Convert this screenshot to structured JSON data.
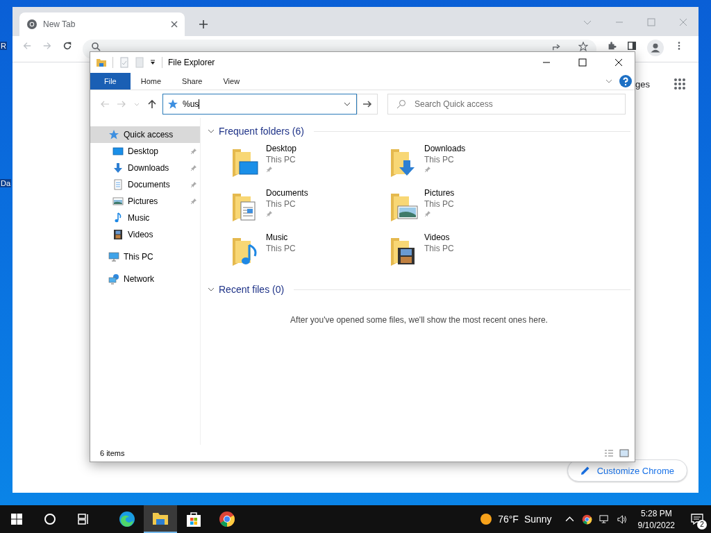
{
  "desktop": {
    "icon_labels": [
      "R",
      "Da"
    ]
  },
  "chrome": {
    "tab": {
      "title": "New Tab"
    },
    "partial_link": "ges",
    "customize_button": "Customize Chrome"
  },
  "explorer": {
    "title": "File Explorer",
    "ribbon_tabs": [
      {
        "label": "File",
        "selected": true
      },
      {
        "label": "Home",
        "selected": false
      },
      {
        "label": "Share",
        "selected": false
      },
      {
        "label": "View",
        "selected": false
      }
    ],
    "address": {
      "value": "%us"
    },
    "search": {
      "placeholder": "Search Quick access"
    },
    "nav": [
      {
        "label": "Quick access",
        "kind": "quick",
        "selected": true,
        "children": [
          {
            "label": "Desktop",
            "kind": "desktop",
            "pinned": true
          },
          {
            "label": "Downloads",
            "kind": "downloads",
            "pinned": true
          },
          {
            "label": "Documents",
            "kind": "documents",
            "pinned": true
          },
          {
            "label": "Pictures",
            "kind": "pictures",
            "pinned": true
          },
          {
            "label": "Music",
            "kind": "music",
            "pinned": false
          },
          {
            "label": "Videos",
            "kind": "videos",
            "pinned": false
          }
        ]
      },
      {
        "label": "This PC",
        "kind": "pc",
        "selected": false
      },
      {
        "label": "Network",
        "kind": "network",
        "selected": false
      }
    ],
    "frequent": {
      "title": "Frequent folders (6)",
      "expanded": true,
      "folders": [
        {
          "name": "Desktop",
          "location": "This PC",
          "pinned": true,
          "kind": "desktop"
        },
        {
          "name": "Downloads",
          "location": "This PC",
          "pinned": true,
          "kind": "downloads"
        },
        {
          "name": "Documents",
          "location": "This PC",
          "pinned": true,
          "kind": "documents"
        },
        {
          "name": "Pictures",
          "location": "This PC",
          "pinned": true,
          "kind": "pictures"
        },
        {
          "name": "Music",
          "location": "This PC",
          "pinned": false,
          "kind": "music"
        },
        {
          "name": "Videos",
          "location": "This PC",
          "pinned": false,
          "kind": "videos"
        }
      ]
    },
    "recent": {
      "title": "Recent files (0)",
      "expanded": true,
      "message": "After you've opened some files, we'll show the most recent ones here."
    },
    "status": "6 items"
  },
  "taskbar": {
    "apps": [
      {
        "kind": "edge",
        "selected": false
      },
      {
        "kind": "explorer",
        "selected": true
      },
      {
        "kind": "store",
        "selected": false
      },
      {
        "kind": "chrome",
        "selected": false
      }
    ],
    "weather": {
      "temperature": "76°F",
      "condition": "Sunny"
    },
    "time": "5:28 PM",
    "date": "9/10/2022",
    "notifications": "2"
  }
}
